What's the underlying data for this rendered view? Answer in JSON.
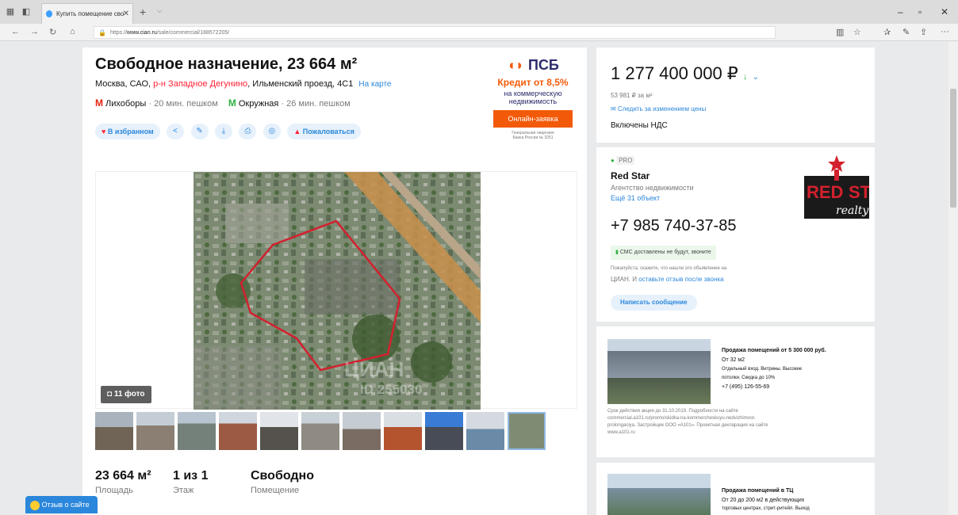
{
  "browser": {
    "tab_title": "Купить помещение сво",
    "url_prefix": "https://",
    "url_domain": "www.cian.ru",
    "url_path": "/sale/commercial/188572205/"
  },
  "listing": {
    "title": "Свободное назначение, 23 664 м²",
    "address_pre": "Москва, САО, ",
    "district": "р-н Западное Дегунино",
    "address_post": ", Ильменский проезд, 4С1",
    "map_link": "На карте",
    "metro": [
      {
        "name": "Лихоборы",
        "time": " · 20 мин. пешком"
      },
      {
        "name": "Окружная",
        "time": " · 26 мин. пешком"
      }
    ],
    "favorite_label": "В избранном",
    "complain_label": "Пожаловаться",
    "photo_count": "11 фото",
    "watermark": "ЦИАН",
    "watermark_id": "ID 255030"
  },
  "bank_ad": {
    "brand": "ПСБ",
    "rate": "Кредит от 8,5%",
    "line1": "на коммерческую",
    "line2": "недвижимость",
    "cta": "Онлайн-заявка",
    "fine1": "Генеральная лицензия",
    "fine2": "Банка России № 3251"
  },
  "summary": [
    {
      "value": "23 664 м²",
      "label": "Площадь"
    },
    {
      "value": "1 из 1",
      "label": "Этаж"
    },
    {
      "value": "Свободно",
      "label": "Помещение"
    }
  ],
  "price": {
    "amount": "1 277 400 000 ₽",
    "per_m2": "53 981 ₽ за м²",
    "follow": "Следить за изменением цены",
    "vat": "Включены НДС"
  },
  "agent": {
    "badge": "PRO",
    "name": "Red Star",
    "type": "Агентство недвижимости",
    "objects": "Ещё 31 объект",
    "phone": "+7 985 740-37-85",
    "sms": "СМС доставлены не будут, звоните",
    "note1": "Пожалуйста, скажите, что нашли это объявление на",
    "note2a": "ЦИАН. И ",
    "note2b": "оставьте отзыв после звонка",
    "message_btn": "Написать сообщение",
    "logo_text1": "RED",
    "logo_text2": "ST",
    "logo_text3": "realty"
  },
  "promo1": {
    "title": "Продажа помещений от 5 300 000 руб.",
    "l1": "От 32 м2",
    "l2": "Отдельный вход. Витрины. Высокие",
    "l3": "потолки. Скидка до 10%",
    "l4": "+7 (495) 126-55-69",
    "fine1": "Срок действия акции до 31.10.2019. Подробности на сайте",
    "fine2": "commercial.a101.ru/promo/skidka-na-kommercheskuyu-nedvizhimost-",
    "fine3": "prolongaciya. Застройщик ООО «А101». Проектная декларация на сайте",
    "fine4": "www.a101.ru"
  },
  "promo2": {
    "title": "Продажа помещений в ТЦ",
    "l1": "От 20 до 200 м2 в действующих",
    "l2": "торговых центрах, стрит-ритейл. Выход"
  },
  "feedback": "Отзыв о сайте",
  "colors": {
    "accent": "#2b87db",
    "red": "#ff1f34",
    "green": "#2fb144",
    "psb_orange": "#f25a0a",
    "parcel": "#d3202e"
  }
}
